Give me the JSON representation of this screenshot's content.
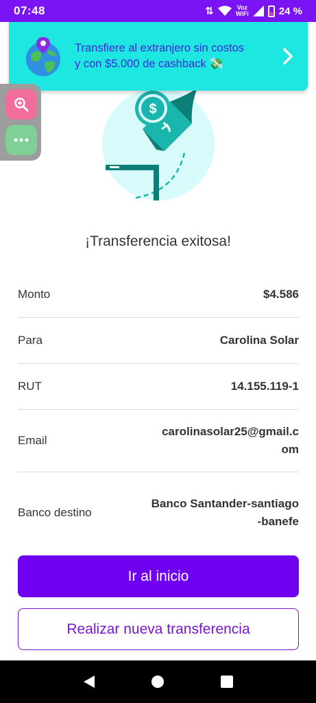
{
  "status_bar": {
    "time": "07:48",
    "network_label_line1": "Voz",
    "network_label_line2": "WiFi",
    "battery": "24 %"
  },
  "promo": {
    "line1": "Transfiere al extranjero sin costos",
    "line2": "y con $5.000 de cashback 💸",
    "icon": "globe-pin-icon",
    "arrow_icon": "chevron-right-icon"
  },
  "floating_tools": {
    "zoom_icon": "zoom-in-icon",
    "more_icon": "more-dots-icon"
  },
  "title": "¡Transferencia exitosa!",
  "details": [
    {
      "label": "Monto",
      "value": "$4.586"
    },
    {
      "label": "Para",
      "value": "Carolina Solar"
    },
    {
      "label": "RUT",
      "value": "14.155.119-1"
    },
    {
      "label": "Email",
      "value": "carolinasolar25@gmail.com"
    },
    {
      "label": "Banco destino",
      "value": "Banco Santander-santiago-banefe"
    }
  ],
  "buttons": {
    "primary": "Ir al inicio",
    "secondary": "Realizar nueva transferencia"
  },
  "colors": {
    "status_bar": "#7a14f5",
    "promo_bg": "#1de7e0",
    "primary": "#7000f0",
    "accent_teal": "#1ab5ad"
  }
}
